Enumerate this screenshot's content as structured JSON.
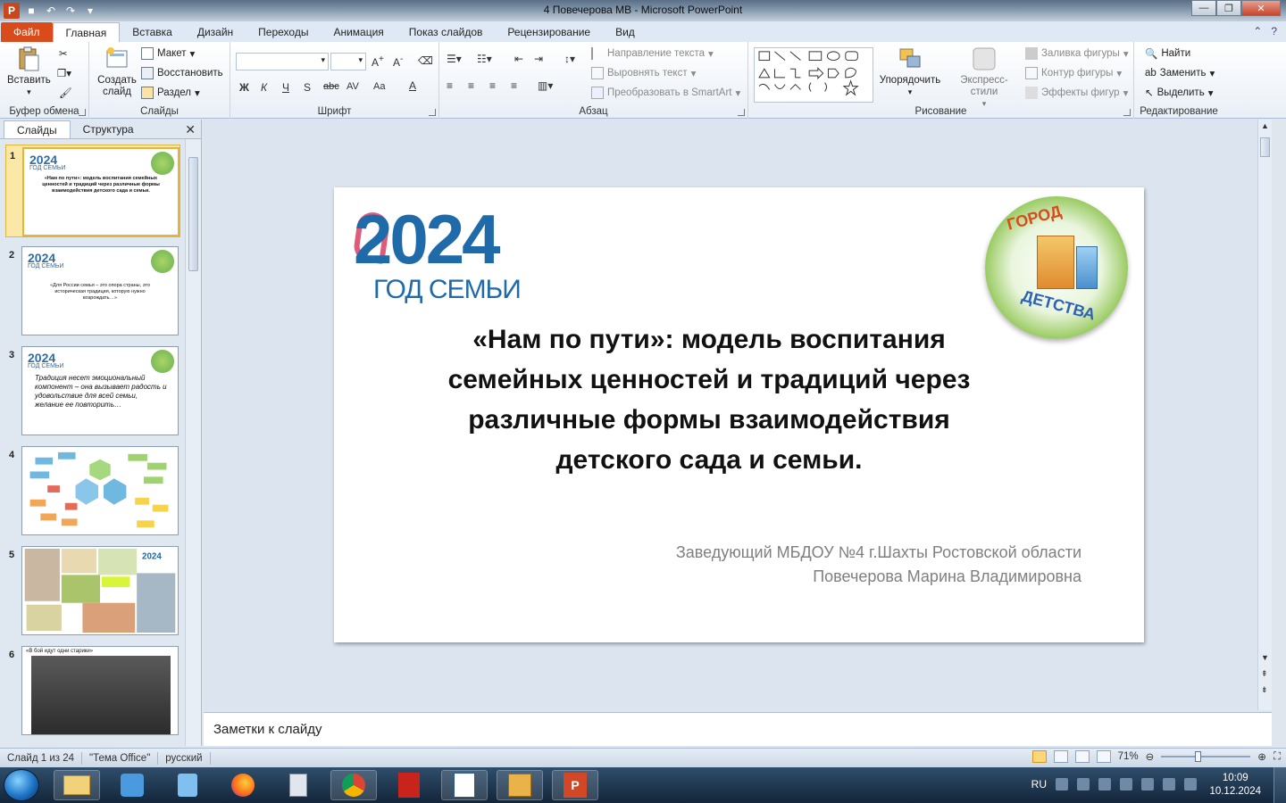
{
  "window": {
    "title": "4 Повечерова МВ  -  Microsoft PowerPoint",
    "app_icon": "P"
  },
  "ribbon_tabs": [
    "Файл",
    "Главная",
    "Вставка",
    "Дизайн",
    "Переходы",
    "Анимация",
    "Показ слайдов",
    "Рецензирование",
    "Вид"
  ],
  "clipboard": {
    "paste": "Вставить",
    "group": "Буфер обмена"
  },
  "slides_group": {
    "new_slide": "Создать слайд",
    "layout": "Макет",
    "reset": "Восстановить",
    "section": "Раздел",
    "group": "Слайды"
  },
  "font_group": {
    "group": "Шрифт",
    "bold": "Ж",
    "italic": "К",
    "underline": "Ч",
    "shadow": "S",
    "strike": "abc",
    "spacing": "AV",
    "case": "Aa"
  },
  "paragraph_group": {
    "group": "Абзац",
    "text_direction": "Направление текста",
    "align_text": "Выровнять текст",
    "smartart": "Преобразовать в SmartArt"
  },
  "drawing_group": {
    "group": "Рисование",
    "arrange": "Упорядочить",
    "quick_styles": "Экспресс-стили",
    "fill": "Заливка фигуры",
    "outline": "Контур фигуры",
    "effects": "Эффекты фигур"
  },
  "editing_group": {
    "group": "Редактирование",
    "find": "Найти",
    "replace": "Заменить",
    "select": "Выделить"
  },
  "left_pane": {
    "tab_slides": "Слайды",
    "tab_outline": "Структура",
    "thumbnails": [
      {
        "num": "1",
        "text": "«Нам по пути»: модель воспитания семейных ценностей и традиций через различные формы взаимодействия детского сада и семьи."
      },
      {
        "num": "2",
        "text": "«Для России семья – это опора страны, это историческая традиция, которую нужно возрождать…»"
      },
      {
        "num": "3",
        "text": "Традиция несет эмоциональный компонент – она вызывает радость и удовольствие для всей семьи, желание ее повторить…"
      },
      {
        "num": "4",
        "text": ""
      },
      {
        "num": "5",
        "text": ""
      },
      {
        "num": "6",
        "text": "«В бой идут одни старики»"
      }
    ]
  },
  "slide": {
    "logo_year": "2024",
    "logo_sub": "ГОД СЕМЬИ",
    "seal_top": "ГОРОД",
    "seal_bottom": "ДЕТСТВА",
    "title": "«Нам по пути»: модель воспитания семейных ценностей и традиций через различные формы взаимодействия детского сада и семьи.",
    "subtitle_line1": "Заведующий МБДОУ №4 г.Шахты Ростовской области",
    "subtitle_line2": "Повечерова Марина Владимировна"
  },
  "notes": {
    "placeholder": "Заметки к слайду"
  },
  "status": {
    "slide_of": "Слайд 1 из 24",
    "theme": "\"Тема Office\"",
    "language": "русский",
    "zoom": "71%"
  },
  "taskbar": {
    "lang": "RU",
    "time": "10:09",
    "date": "10.12.2024"
  }
}
